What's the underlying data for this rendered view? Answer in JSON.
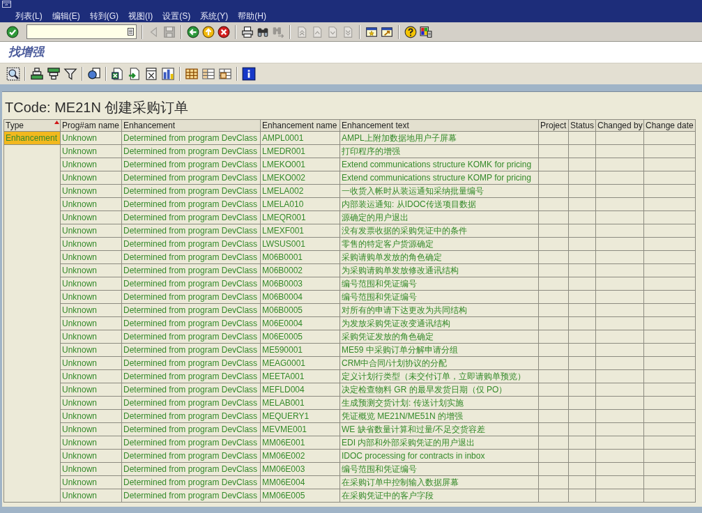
{
  "menu_bar": [
    "列表(L)",
    "编辑(E)",
    "转到(G)",
    "视图(I)",
    "设置(S)",
    "系统(Y)",
    "帮助(H)"
  ],
  "system_toolbar": [
    {
      "kind": "enter",
      "disabled": false
    },
    {
      "kind": "field"
    },
    {
      "kind": "separator"
    },
    {
      "kind": "arrow",
      "disabled": true
    },
    {
      "kind": "save",
      "disabled": true
    },
    {
      "kind": "separator"
    },
    {
      "kind": "back",
      "disabled": false
    },
    {
      "kind": "exit",
      "disabled": false
    },
    {
      "kind": "cancel",
      "disabled": false
    },
    {
      "kind": "separator"
    },
    {
      "kind": "print",
      "disabled": false
    },
    {
      "kind": "find",
      "disabled": false
    },
    {
      "kind": "findnext",
      "disabled": true
    },
    {
      "kind": "separator"
    },
    {
      "kind": "first",
      "disabled": true
    },
    {
      "kind": "previous",
      "disabled": true
    },
    {
      "kind": "next",
      "disabled": true
    },
    {
      "kind": "last",
      "disabled": true
    },
    {
      "kind": "separator"
    },
    {
      "kind": "session",
      "disabled": false
    },
    {
      "kind": "shortcut",
      "disabled": false
    },
    {
      "kind": "separator"
    },
    {
      "kind": "help",
      "disabled": false
    },
    {
      "kind": "layout",
      "disabled": false
    }
  ],
  "screen_title": "找增强",
  "app_toolbar": [
    {
      "kind": "details"
    },
    {
      "kind": "separator"
    },
    {
      "kind": "ascending"
    },
    {
      "kind": "descending"
    },
    {
      "kind": "filter"
    },
    {
      "kind": "separator"
    },
    {
      "kind": "graphics"
    },
    {
      "kind": "separator"
    },
    {
      "kind": "spreadsheet"
    },
    {
      "kind": "export"
    },
    {
      "kind": "wordproc"
    },
    {
      "kind": "chart"
    },
    {
      "kind": "separator"
    },
    {
      "kind": "grid"
    },
    {
      "kind": "table"
    },
    {
      "kind": "tableselect"
    },
    {
      "kind": "separator"
    },
    {
      "kind": "info"
    }
  ],
  "report": {
    "title": "TCode: ME21N 创建采购订单",
    "columns": [
      {
        "label": "Type",
        "sorted": true
      },
      {
        "label": "Prog#am name",
        "sorted": false
      },
      {
        "label": "Enhancement",
        "sorted": false
      },
      {
        "label": "Enhancement name",
        "sorted": false
      },
      {
        "label": "Enhancement text",
        "sorted": false
      },
      {
        "label": "Project",
        "sorted": false
      },
      {
        "label": "Status",
        "sorted": false
      },
      {
        "label": "Changed by",
        "sorted": false
      },
      {
        "label": "Change date",
        "sorted": false
      }
    ],
    "type_group": {
      "text": "Enhancement",
      "selected": true
    },
    "rows": [
      {
        "program": "Unknown",
        "enhancement": "Determined from program DevClass",
        "name": "AMPL0001",
        "text": "AMPL上附加数据地用户子屏幕"
      },
      {
        "program": "Unknown",
        "enhancement": "Determined from program DevClass",
        "name": "LMEDR001",
        "text": "打印程序的增强"
      },
      {
        "program": "Unknown",
        "enhancement": "Determined from program DevClass",
        "name": "LMEKO001",
        "text": "Extend communications structure KOMK for pricing"
      },
      {
        "program": "Unknown",
        "enhancement": "Determined from program DevClass",
        "name": "LMEKO002",
        "text": "Extend communications structure KOMP for pricing"
      },
      {
        "program": "Unknown",
        "enhancement": "Determined from program DevClass",
        "name": "LMELA002",
        "text": "一收货入帐时从装运通知采纳批量编号"
      },
      {
        "program": "Unknown",
        "enhancement": "Determined from program DevClass",
        "name": "LMELA010",
        "text": "内部装运通知: 从IDOC传送项目数据"
      },
      {
        "program": "Unknown",
        "enhancement": "Determined from program DevClass",
        "name": "LMEQR001",
        "text": "源确定的用户退出"
      },
      {
        "program": "Unknown",
        "enhancement": "Determined from program DevClass",
        "name": "LMEXF001",
        "text": "没有发票收据的采购凭证中的条件"
      },
      {
        "program": "Unknown",
        "enhancement": "Determined from program DevClass",
        "name": "LWSUS001",
        "text": "零售的特定客户货源确定"
      },
      {
        "program": "Unknown",
        "enhancement": "Determined from program DevClass",
        "name": "M06B0001",
        "text": "采购请购单发放的角色确定"
      },
      {
        "program": "Unknown",
        "enhancement": "Determined from program DevClass",
        "name": "M06B0002",
        "text": "为采购请购单发放修改通讯结构"
      },
      {
        "program": "Unknown",
        "enhancement": "Determined from program DevClass",
        "name": "M06B0003",
        "text": "编号范围和凭证编号"
      },
      {
        "program": "Unknown",
        "enhancement": "Determined from program DevClass",
        "name": "M06B0004",
        "text": "编号范围和凭证编号"
      },
      {
        "program": "Unknown",
        "enhancement": "Determined from program DevClass",
        "name": "M06B0005",
        "text": "对所有的申请下达更改为共同结构"
      },
      {
        "program": "Unknown",
        "enhancement": "Determined from program DevClass",
        "name": "M06E0004",
        "text": "为发放采购凭证改变通讯结构"
      },
      {
        "program": "Unknown",
        "enhancement": "Determined from program DevClass",
        "name": "M06E0005",
        "text": "采购凭证发放的角色确定"
      },
      {
        "program": "Unknown",
        "enhancement": "Determined from program DevClass",
        "name": "ME590001",
        "text": "ME59 中采购订单分解申请分组"
      },
      {
        "program": "Unknown",
        "enhancement": "Determined from program DevClass",
        "name": "MEAG0001",
        "text": "CRM中合同/计划协议的分配"
      },
      {
        "program": "Unknown",
        "enhancement": "Determined from program DevClass",
        "name": "MEETA001",
        "text": "定义计划行类型（未交付订单，立即请购单预览）"
      },
      {
        "program": "Unknown",
        "enhancement": "Determined from program DevClass",
        "name": "MEFLD004",
        "text": "决定检查物料 GR 的最早发货日期（仅 PO）"
      },
      {
        "program": "Unknown",
        "enhancement": "Determined from program DevClass",
        "name": "MELAB001",
        "text": "生成预测交货计划: 传送计划实施"
      },
      {
        "program": "Unknown",
        "enhancement": "Determined from program DevClass",
        "name": "MEQUERY1",
        "text": "凭证概览 ME21N/ME51N 的增强"
      },
      {
        "program": "Unknown",
        "enhancement": "Determined from program DevClass",
        "name": "MEVME001",
        "text": "WE 缺省数量计算和过量/不足交货容差"
      },
      {
        "program": "Unknown",
        "enhancement": "Determined from program DevClass",
        "name": "MM06E001",
        "text": "EDI 内部和外部采购凭证的用户退出"
      },
      {
        "program": "Unknown",
        "enhancement": "Determined from program DevClass",
        "name": "MM06E002",
        "text": "IDOC processing for contracts in inbox"
      },
      {
        "program": "Unknown",
        "enhancement": "Determined from program DevClass",
        "name": "MM06E003",
        "text": "编号范围和凭证编号"
      },
      {
        "program": "Unknown",
        "enhancement": "Determined from program DevClass",
        "name": "MM06E004",
        "text": "在采购订单中控制输入数据屏幕"
      },
      {
        "program": "Unknown",
        "enhancement": "Determined from program DevClass",
        "name": "MM06E005",
        "text": "在采购凭证中的客户字段"
      }
    ]
  }
}
